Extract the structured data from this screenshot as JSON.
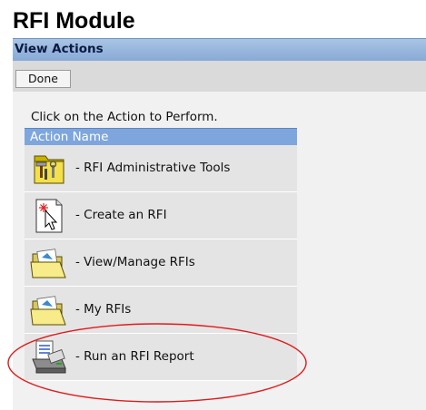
{
  "module": {
    "title": "RFI Module"
  },
  "header": {
    "title": "View Actions"
  },
  "toolbar": {
    "done_label": "Done"
  },
  "instruction": "Click on the Action to Perform.",
  "table": {
    "column_header": "Action Name",
    "rows": [
      {
        "label": "- RFI Administrative Tools",
        "icon": "admin-tools-folder-icon"
      },
      {
        "label": "- Create an RFI",
        "icon": "new-document-cursor-icon"
      },
      {
        "label": "- View/Manage RFIs",
        "icon": "open-folder-icon"
      },
      {
        "label": "- My RFIs",
        "icon": "open-folder-icon"
      },
      {
        "label": "- Run an RFI Report",
        "icon": "printer-report-icon"
      }
    ]
  },
  "annotation": {
    "shape": "ellipse",
    "color": "#e11a1a",
    "highlights": "- Run an RFI Report"
  }
}
